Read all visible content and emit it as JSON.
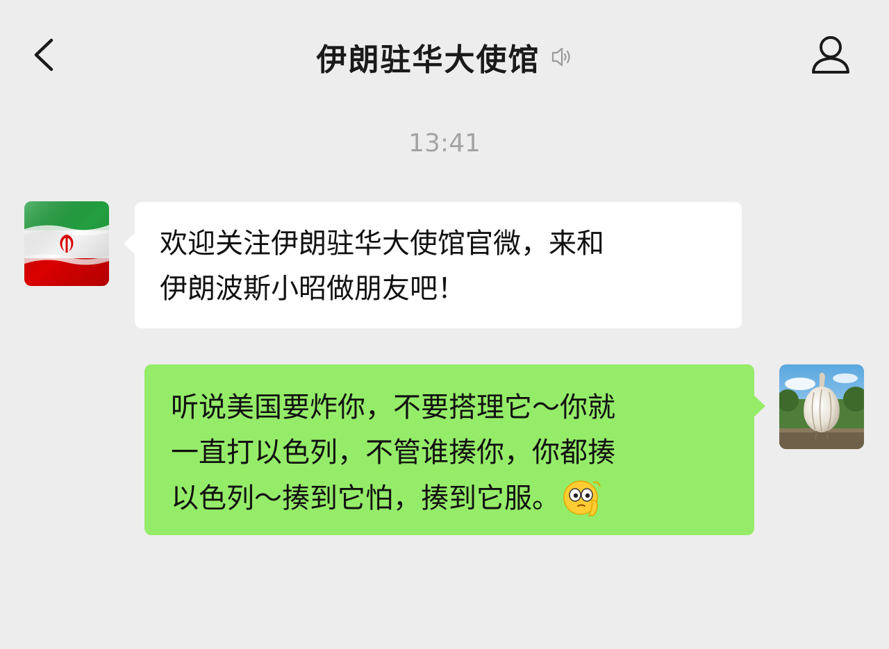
{
  "header": {
    "title": "伊朗驻华大使馆",
    "back_icon": "chevron-left-icon",
    "mute_icon": "speaker-muted-icon",
    "profile_icon": "person-icon"
  },
  "timestamp": "13:41",
  "messages": [
    {
      "direction": "incoming",
      "avatar": "iran-flag-avatar",
      "lines": [
        "欢迎关注伊朗驻华大使馆官微，来和",
        "伊朗波斯小昭做朋友吧！"
      ]
    },
    {
      "direction": "outgoing",
      "avatar": "garlic-avatar",
      "lines": [
        "听说美国要炸你，不要搭理它～你就",
        "一直打以色列，不管谁揍你，你都揍",
        "以色列～揍到它怕，揍到它服。"
      ],
      "emoji": "thinking-face-emoji"
    }
  ],
  "colors": {
    "background": "#ededed",
    "incoming_bubble": "#ffffff",
    "outgoing_bubble": "#95ec69",
    "timestamp": "#a3a3a3"
  }
}
